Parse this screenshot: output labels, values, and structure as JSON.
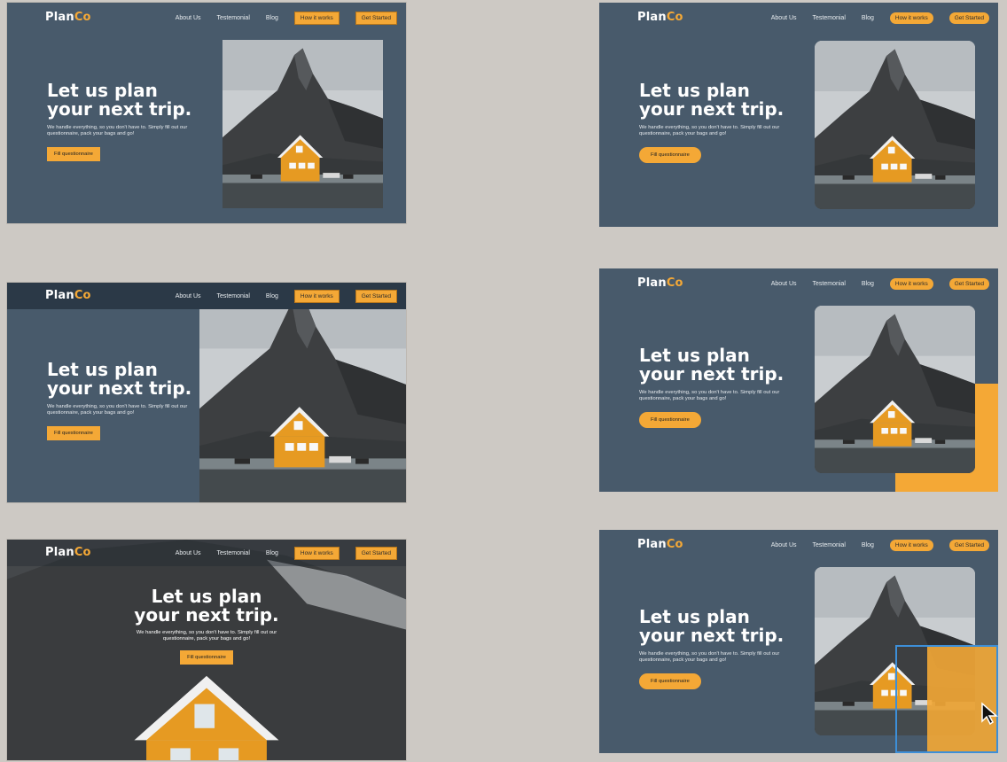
{
  "brand": {
    "logo_main": "Plan",
    "logo_accent": "Co",
    "accent_color": "#f4a836",
    "bg_color": "#485a6b"
  },
  "nav": {
    "about": "About Us",
    "testimonial": "Testemonial",
    "blog": "Blog",
    "how": "How it works",
    "start": "Get Started"
  },
  "hero": {
    "title_line1": "Let us plan",
    "title_line2": "your next trip.",
    "body": "We handle everything, so you don't have to. Simply fill out our questionnaire, pack your bags and go!",
    "cta": "Fill questionnaire"
  },
  "icons": {
    "cursor": "arrow-cursor-icon"
  }
}
